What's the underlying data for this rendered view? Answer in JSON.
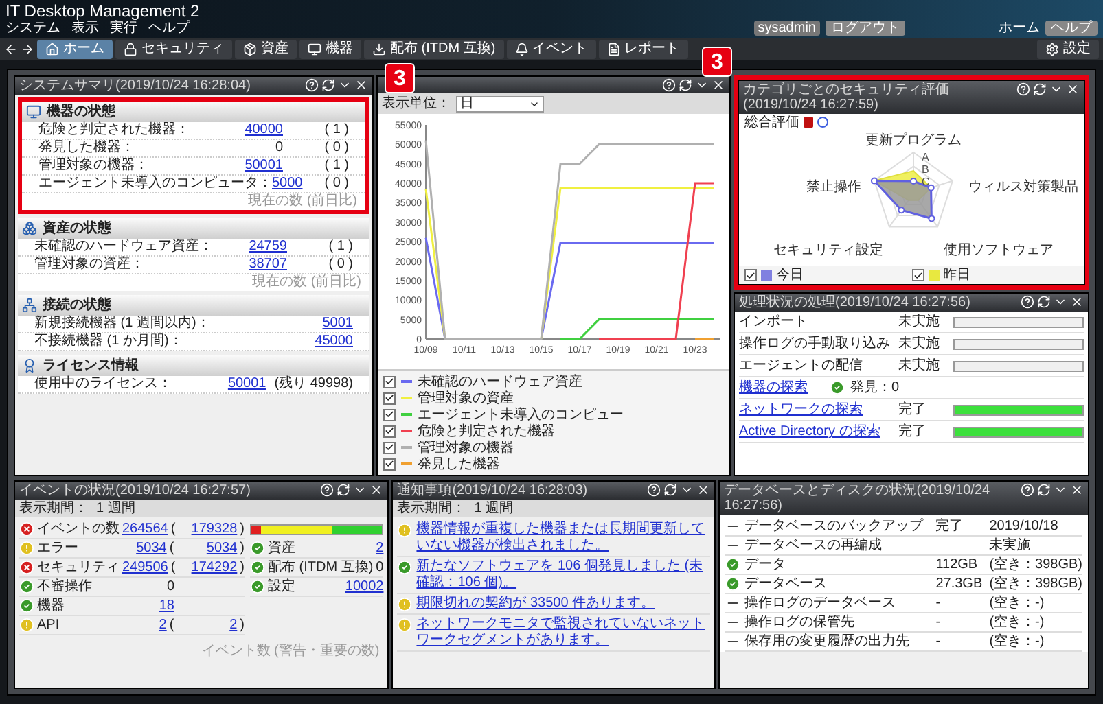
{
  "app": {
    "title": "IT Desktop Management 2",
    "menu": [
      "システム",
      "表示",
      "実行",
      "ヘルプ"
    ],
    "user": "sysadmin",
    "logout": "ログアウト",
    "home": "ホーム",
    "help": "ヘルプ",
    "settings": "設定"
  },
  "nav_tabs": [
    {
      "label": "ホーム",
      "selected": true
    },
    {
      "label": "セキュリティ",
      "selected": false
    },
    {
      "label": "資産",
      "selected": false
    },
    {
      "label": "機器",
      "selected": false
    },
    {
      "label": "配布 (ITDM 互換)",
      "selected": false
    },
    {
      "label": "イベント",
      "selected": false
    },
    {
      "label": "レポート",
      "selected": false
    }
  ],
  "summary": {
    "title": "システムサマリ(2019/10/24 16:28:04)",
    "sections": [
      {
        "title": "機器の状態",
        "annotation": "3",
        "rows": [
          {
            "label": "危険と判定された機器：",
            "value": "40000",
            "link": true,
            "delta": "( 1 )"
          },
          {
            "label": "発見した機器：",
            "value": "0",
            "link": false,
            "delta": "( 0 )"
          },
          {
            "label": "管理対象の機器：",
            "value": "50001",
            "link": true,
            "delta": "( 1 )"
          },
          {
            "label": "エージェント未導入のコンピュータ：",
            "value": "5000",
            "link": true,
            "delta": "( 0 )"
          }
        ],
        "note": "現在の数 (前日比)"
      },
      {
        "title": "資産の状態",
        "rows": [
          {
            "label": "未確認のハードウェア資産：",
            "value": "24759",
            "link": true,
            "delta": "( 1 )"
          },
          {
            "label": "管理対象の資産：",
            "value": "38707",
            "link": true,
            "delta": "( 0 )"
          }
        ],
        "note": "現在の数 (前日比)"
      },
      {
        "title": "接続の状態",
        "rows": [
          {
            "label": "新規接続機器 (1 週間以内)：",
            "value": "5001",
            "link": true
          },
          {
            "label": "不接続機器 (1 か月間)：",
            "value": "45000",
            "link": true
          }
        ]
      },
      {
        "title": "ライセンス情報",
        "rows": [
          {
            "label": "使用中のライセンス：",
            "value": "50001",
            "link": true,
            "extra": "(残り 49998)"
          }
        ]
      }
    ]
  },
  "trend": {
    "unit_label": "表示単位：",
    "unit": "日",
    "chart_data": {
      "type": "line",
      "categories": [
        "10/09",
        null,
        "10/11",
        null,
        "10/13",
        null,
        "10/15",
        null,
        "10/17",
        null,
        "10/19",
        null,
        "10/21",
        null,
        "10/23",
        null
      ],
      "ylim": [
        0,
        55000
      ],
      "yticks": [
        0,
        5000,
        10000,
        15000,
        20000,
        25000,
        30000,
        35000,
        40000,
        45000,
        50000,
        55000
      ],
      "series": [
        {
          "name": "未確認のハードウェア資産",
          "color": "#6a6af0",
          "values": [
            26000,
            0,
            null,
            null,
            null,
            null,
            0,
            24800,
            24800,
            24800,
            24800,
            24800,
            24800,
            24800,
            24800,
            24800
          ]
        },
        {
          "name": "管理対象の資産",
          "color": "#f0f040",
          "values": [
            38500,
            0,
            null,
            null,
            null,
            null,
            0,
            38700,
            38700,
            38700,
            38700,
            38700,
            38700,
            38700,
            38700,
            38700
          ]
        },
        {
          "name": "エージェント未導入のコンピュー",
          "color": "#40d040",
          "values": [
            null,
            null,
            null,
            null,
            null,
            null,
            null,
            0,
            0,
            5000,
            5000,
            5000,
            5000,
            5000,
            5000,
            5000
          ]
        },
        {
          "name": "危険と判定された機器",
          "color": "#f04050",
          "values": [
            null,
            null,
            null,
            null,
            null,
            null,
            null,
            null,
            null,
            0,
            0,
            0,
            0,
            0,
            40000,
            40000
          ]
        },
        {
          "name": "管理対象の機器",
          "color": "#b0b0b0",
          "values": [
            51000,
            0,
            0,
            0,
            0,
            0,
            0,
            45000,
            45000,
            50000,
            50000,
            50000,
            50000,
            50000,
            50000,
            50000
          ]
        },
        {
          "name": "発見した機器",
          "color": "#f0a030",
          "values": [
            null,
            null,
            null,
            null,
            null,
            null,
            null,
            null,
            null,
            null,
            null,
            null,
            null,
            null,
            0,
            0
          ]
        }
      ]
    },
    "legend": [
      {
        "checked": true
      },
      {
        "checked": true
      },
      {
        "checked": true
      },
      {
        "checked": true
      },
      {
        "checked": true
      },
      {
        "checked": true
      }
    ]
  },
  "security": {
    "title": "カテゴリごとのセキュリティ評価(2019/10/24 16:27:59)",
    "annotation": "3",
    "overall_label": "総合評価",
    "axes": [
      "更新プログラム",
      "禁止操作",
      "ウィルス対策製品",
      "セキュリティ設定",
      "使用ソフトウェア"
    ],
    "grades": [
      "A",
      "B",
      "C"
    ],
    "legend": [
      {
        "label": "今日",
        "color": "#8080e0",
        "checked": true
      },
      {
        "label": "昨日",
        "color": "#e8e840",
        "checked": true
      }
    ]
  },
  "processes": {
    "title": "処理状況の処理(2019/10/24 16:27:56)",
    "rows": [
      {
        "kind": "progress",
        "label": "インポート",
        "link": false,
        "status": "未実施",
        "level": 0
      },
      {
        "kind": "progress",
        "label": "操作ログの手動取り込み",
        "link": false,
        "status": "未実施",
        "level": 0
      },
      {
        "kind": "progress",
        "label": "エージェントの配信",
        "link": false,
        "status": "未実施",
        "level": 0
      },
      {
        "kind": "discovery",
        "label": "機器の探索",
        "link": true,
        "result": "発見：0"
      },
      {
        "kind": "progress",
        "label": "ネットワークの探索",
        "link": true,
        "status": "完了",
        "level": 1
      },
      {
        "kind": "progress",
        "label": "Active Directory の探索",
        "link": true,
        "status": "完了",
        "level": 1
      }
    ]
  },
  "events": {
    "title": "イベントの状況(2019/10/24 16:27:57)",
    "period_label": "表示期間：",
    "period": "1 週間",
    "rows": [
      {
        "kind": "error",
        "label": "イベントの数",
        "value": "264564",
        "link": true,
        "open": "(",
        "paren": "179328",
        "close": ")"
      },
      {
        "kind": "warning",
        "label": "エラー",
        "value": "5034",
        "link": true,
        "open": "(",
        "paren": "5034",
        "close": ")"
      },
      {
        "kind": "error",
        "label": "セキュリティ",
        "value": "249506",
        "link": true,
        "open": "(",
        "paren": "174292",
        "close": ")"
      },
      {
        "kind": "ok",
        "label": "不審操作",
        "value": "0",
        "link": false
      },
      {
        "kind": "ok",
        "label": "機器",
        "value": "18",
        "link": true
      },
      {
        "kind": "warning",
        "label": "API",
        "value": "2",
        "link": true,
        "open": "(",
        "paren": "2",
        "close": ")"
      }
    ],
    "bar": [
      {
        "kind": "error",
        "level": 0.07
      },
      {
        "kind": "warning",
        "level": 0.62
      },
      {
        "kind": "ok",
        "level": 1
      }
    ],
    "side_rows": [
      {
        "kind": "ok",
        "label": "資産",
        "value": "2",
        "link": true
      },
      {
        "kind": "ok",
        "label": "配布 (ITDM 互換)",
        "value": "0",
        "link": false
      },
      {
        "kind": "ok",
        "label": "設定",
        "value": "10002",
        "link": true
      }
    ],
    "note": "イベント数 (警告・重要の数)"
  },
  "notices": {
    "title": "通知事項(2019/10/24 16:28:03)",
    "period_label": "表示期間：",
    "period": "1 週間",
    "items": [
      {
        "kind": "warning",
        "text": "機器情報が重複した機器または長期間更新していない機器が検出されました。"
      },
      {
        "kind": "ok",
        "text": "新たなソフトウェアを 106 個発見しました (未確認：106 個)。"
      },
      {
        "kind": "warning",
        "text": "期限切れの契約が 33500 件あります。"
      },
      {
        "kind": "warning",
        "text": "ネットワークモニタで監視されていないネットワークセグメントがあります。"
      }
    ]
  },
  "database": {
    "title": "データベースとディスクの状況(2019/10/24 16:27:56)",
    "rows": [
      {
        "kind": "dash",
        "label": "データベースのバックアップ",
        "value": "完了",
        "extra": "2019/10/18"
      },
      {
        "kind": "dash",
        "label": "データベースの再編成",
        "extra": "未実施"
      },
      {
        "kind": "ok",
        "label": "データ",
        "value": "112GB",
        "extra": "(空き：398GB)"
      },
      {
        "kind": "ok",
        "label": "データベース",
        "value": "27.3GB",
        "extra": "(空き：398GB)"
      },
      {
        "kind": "dash",
        "label": "操作ログのデータベース",
        "value": "-",
        "extra": "(空き：-)"
      },
      {
        "kind": "dash",
        "label": "操作ログの保管先",
        "value": "-",
        "extra": "(空き：-)"
      },
      {
        "kind": "dash",
        "label": "保存用の変更履歴の出力先",
        "value": "-",
        "extra": "(空き：-)"
      }
    ]
  }
}
